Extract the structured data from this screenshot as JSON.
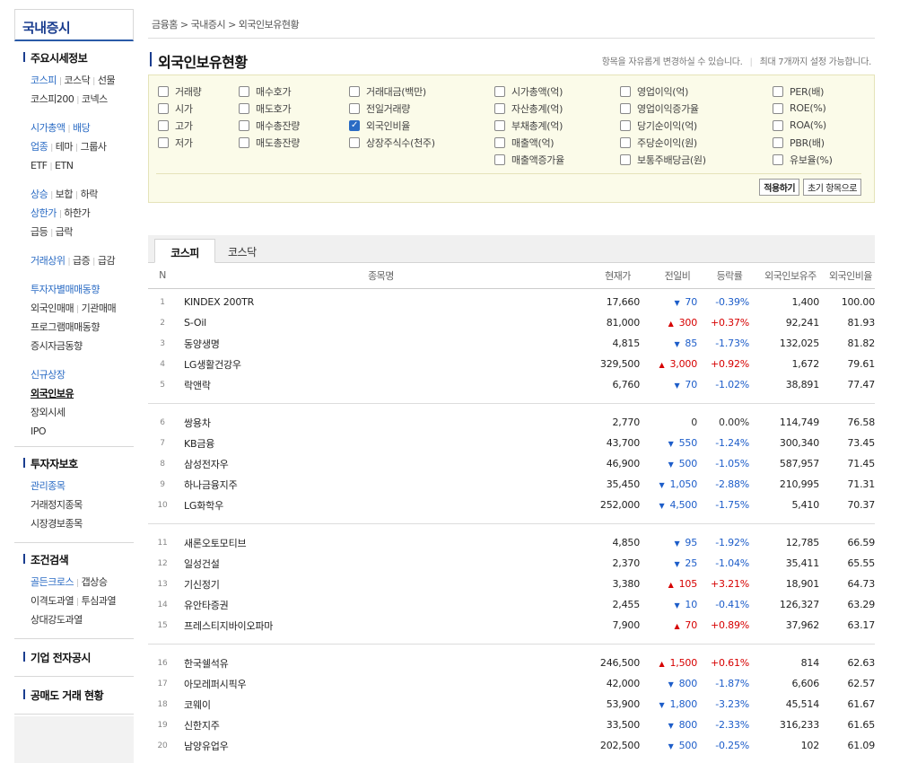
{
  "sidebar": {
    "title": "국내증시",
    "section1_title": "주요시세정보",
    "s1": {
      "kospi": "코스피",
      "kosdaq": "코스닥",
      "futures": "선물",
      "kospi200": "코스피200",
      "konex": "코넥스",
      "mcap": "시가총액",
      "dividend": "배당",
      "sector": "업종",
      "theme": "테마",
      "group": "그룹사",
      "etf": "ETF",
      "etn": "ETN",
      "rise": "상승",
      "steady": "보합",
      "fall": "하락",
      "upper": "상한가",
      "lower": "하한가",
      "surge": "급등",
      "plunge": "급락",
      "vol_top": "거래상위",
      "vol_surge": "급증",
      "vol_drop": "급감",
      "investor": "투자자별매매동향",
      "foreign_trade": "외국인매매",
      "inst_trade": "기관매매",
      "program": "프로그램매매동향",
      "deposit": "증시자금동향",
      "new_listing": "신규상장",
      "foreign_hold": "외국인보유",
      "off_hours": "장외시세",
      "ipo": "IPO"
    },
    "section2_title": "투자자보호",
    "s2": {
      "managed": "관리종목",
      "halted": "거래정지종목",
      "warning": "시장경보종목"
    },
    "section3_title": "조건검색",
    "s3": {
      "golden": "골든크로스",
      "gap": "갭상승",
      "disparity": "이격도과열",
      "psych": "투심과열",
      "rsi": "상대강도과열"
    },
    "section4_title": "기업 전자공시",
    "section5_title": "공매도 거래 현황"
  },
  "breadcrumb": {
    "home": "금융홈",
    "sep": ">",
    "domestic": "국내증시",
    "current": "외국인보유현황"
  },
  "page_title": "외국인보유현황",
  "notice": {
    "left": "항목을 자유롭게 변경하실 수 있습니다.",
    "bar": "|",
    "right": "최대 7개까지 설정 가능합니다."
  },
  "options": {
    "col1": [
      {
        "label": "거래량",
        "checked": false
      },
      {
        "label": "시가",
        "checked": false
      },
      {
        "label": "고가",
        "checked": false
      },
      {
        "label": "저가",
        "checked": false
      }
    ],
    "col2": [
      {
        "label": "매수호가",
        "checked": false
      },
      {
        "label": "매도호가",
        "checked": false
      },
      {
        "label": "매수총잔량",
        "checked": false
      },
      {
        "label": "매도총잔량",
        "checked": false
      }
    ],
    "col3": [
      {
        "label": "거래대금(백만)",
        "checked": false
      },
      {
        "label": "전일거래량",
        "checked": false
      },
      {
        "label": "외국인비율",
        "checked": true
      },
      {
        "label": "상장주식수(천주)",
        "checked": false
      }
    ],
    "col4": [
      {
        "label": "시가총액(억)",
        "checked": false
      },
      {
        "label": "자산총계(억)",
        "checked": false
      },
      {
        "label": "부채총계(억)",
        "checked": false
      },
      {
        "label": "매출액(억)",
        "checked": false
      },
      {
        "label": "매출액증가율",
        "checked": false
      }
    ],
    "col5": [
      {
        "label": "영업이익(억)",
        "checked": false
      },
      {
        "label": "영업이익증가율",
        "checked": false
      },
      {
        "label": "당기순이익(억)",
        "checked": false
      },
      {
        "label": "주당순이익(원)",
        "checked": false
      },
      {
        "label": "보통주배당금(원)",
        "checked": false
      }
    ],
    "col6": [
      {
        "label": "PER(배)",
        "checked": false
      },
      {
        "label": "ROE(%)",
        "checked": false
      },
      {
        "label": "ROA(%)",
        "checked": false
      },
      {
        "label": "PBR(배)",
        "checked": false
      },
      {
        "label": "유보율(%)",
        "checked": false
      }
    ],
    "apply_label": "적용하기",
    "reset_label": "초기 항목으로"
  },
  "tabs": {
    "active": "코스피",
    "inactive": "코스닥"
  },
  "table": {
    "headers": [
      "N",
      "종목명",
      "현재가",
      "전일비",
      "등락률",
      "외국인보유주",
      "외국인비율"
    ],
    "rows": [
      {
        "n": "1",
        "name": "KINDEX 200TR",
        "price": "17,660",
        "dir": "dn",
        "change": "70",
        "rate": "-0.39%",
        "hold": "1,400",
        "ratio": "100.00"
      },
      {
        "n": "2",
        "name": "S-Oil",
        "price": "81,000",
        "dir": "up",
        "change": "300",
        "rate": "+0.37%",
        "hold": "92,241",
        "ratio": "81.93"
      },
      {
        "n": "3",
        "name": "동양생명",
        "price": "4,815",
        "dir": "dn",
        "change": "85",
        "rate": "-1.73%",
        "hold": "132,025",
        "ratio": "81.82"
      },
      {
        "n": "4",
        "name": "LG생활건강우",
        "price": "329,500",
        "dir": "up",
        "change": "3,000",
        "rate": "+0.92%",
        "hold": "1,672",
        "ratio": "79.61"
      },
      {
        "n": "5",
        "name": "락앤락",
        "price": "6,760",
        "dir": "dn",
        "change": "70",
        "rate": "-1.02%",
        "hold": "38,891",
        "ratio": "77.47"
      },
      {
        "n": "6",
        "name": "쌍용차",
        "price": "2,770",
        "dir": "flat",
        "change": "0",
        "rate": "0.00%",
        "hold": "114,749",
        "ratio": "76.58"
      },
      {
        "n": "7",
        "name": "KB금융",
        "price": "43,700",
        "dir": "dn",
        "change": "550",
        "rate": "-1.24%",
        "hold": "300,340",
        "ratio": "73.45"
      },
      {
        "n": "8",
        "name": "삼성전자우",
        "price": "46,900",
        "dir": "dn",
        "change": "500",
        "rate": "-1.05%",
        "hold": "587,957",
        "ratio": "71.45"
      },
      {
        "n": "9",
        "name": "하나금융지주",
        "price": "35,450",
        "dir": "dn",
        "change": "1,050",
        "rate": "-2.88%",
        "hold": "210,995",
        "ratio": "71.31"
      },
      {
        "n": "10",
        "name": "LG화학우",
        "price": "252,000",
        "dir": "dn",
        "change": "4,500",
        "rate": "-1.75%",
        "hold": "5,410",
        "ratio": "70.37"
      },
      {
        "n": "11",
        "name": "새론오토모티브",
        "price": "4,850",
        "dir": "dn",
        "change": "95",
        "rate": "-1.92%",
        "hold": "12,785",
        "ratio": "66.59"
      },
      {
        "n": "12",
        "name": "일성건설",
        "price": "2,370",
        "dir": "dn",
        "change": "25",
        "rate": "-1.04%",
        "hold": "35,411",
        "ratio": "65.55"
      },
      {
        "n": "13",
        "name": "기신정기",
        "price": "3,380",
        "dir": "up",
        "change": "105",
        "rate": "+3.21%",
        "hold": "18,901",
        "ratio": "64.73"
      },
      {
        "n": "14",
        "name": "유안타증권",
        "price": "2,455",
        "dir": "dn",
        "change": "10",
        "rate": "-0.41%",
        "hold": "126,327",
        "ratio": "63.29"
      },
      {
        "n": "15",
        "name": "프레스티지바이오파마",
        "price": "7,900",
        "dir": "up",
        "change": "70",
        "rate": "+0.89%",
        "hold": "37,962",
        "ratio": "63.17"
      },
      {
        "n": "16",
        "name": "한국쉘석유",
        "price": "246,500",
        "dir": "up",
        "change": "1,500",
        "rate": "+0.61%",
        "hold": "814",
        "ratio": "62.63"
      },
      {
        "n": "17",
        "name": "아모레퍼시픽우",
        "price": "42,000",
        "dir": "dn",
        "change": "800",
        "rate": "-1.87%",
        "hold": "6,606",
        "ratio": "62.57"
      },
      {
        "n": "18",
        "name": "코웨이",
        "price": "53,900",
        "dir": "dn",
        "change": "1,800",
        "rate": "-3.23%",
        "hold": "45,514",
        "ratio": "61.67"
      },
      {
        "n": "19",
        "name": "신한지주",
        "price": "33,500",
        "dir": "dn",
        "change": "800",
        "rate": "-2.33%",
        "hold": "316,233",
        "ratio": "61.65"
      },
      {
        "n": "20",
        "name": "남양유업우",
        "price": "202,500",
        "dir": "dn",
        "change": "500",
        "rate": "-0.25%",
        "hold": "102",
        "ratio": "61.09"
      }
    ]
  }
}
